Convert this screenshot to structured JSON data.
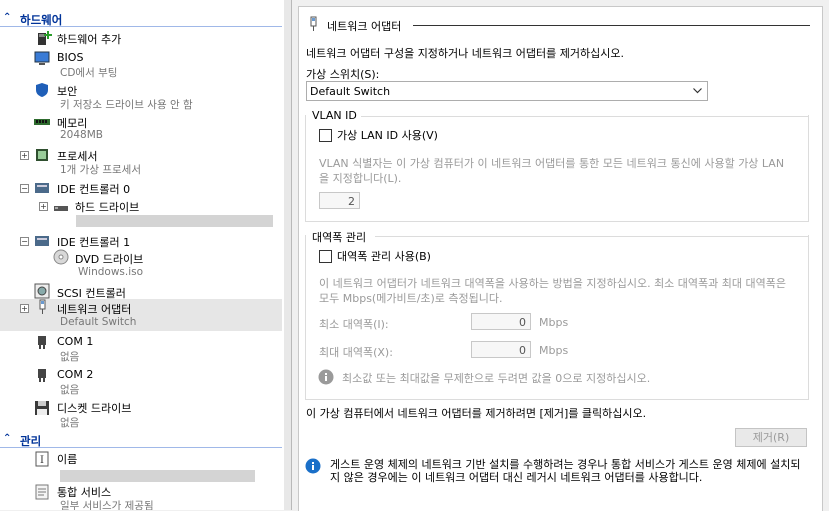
{
  "sidebar": {
    "hardware_header": "하드웨어",
    "management_header": "관리",
    "items": [
      {
        "label": "하드웨어 추가",
        "sub": ""
      },
      {
        "label": "BIOS",
        "sub": "CD에서 부팅"
      },
      {
        "label": "보안",
        "sub": "키 저장소 드라이브 사용 안 함"
      },
      {
        "label": "메모리",
        "sub": "2048MB"
      },
      {
        "label": "프로세서",
        "sub": "1개 가상 프로세서"
      },
      {
        "label": "IDE 컨트롤러 0",
        "sub": ""
      },
      {
        "label": "하드 드라이브",
        "sub": ""
      },
      {
        "label": "IDE 컨트롤러 1",
        "sub": ""
      },
      {
        "label": "DVD 드라이브",
        "sub": "Windows.iso"
      },
      {
        "label": "SCSI 컨트롤러",
        "sub": ""
      },
      {
        "label": "네트워크 어댑터",
        "sub": "Default Switch"
      },
      {
        "label": "COM 1",
        "sub": "없음"
      },
      {
        "label": "COM 2",
        "sub": "없음"
      },
      {
        "label": "디스켓 드라이브",
        "sub": "없음"
      }
    ],
    "mgmt_items": [
      {
        "label": "이름",
        "sub": ""
      },
      {
        "label": "통합 서비스",
        "sub": "일부 서비스가 제공됨"
      }
    ]
  },
  "panel": {
    "title": "네트워크 어댑터",
    "description": "네트워크 어댑터 구성을 지정하거나 네트워크 어댑터를 제거하십시오.",
    "switch_label": "가상 스위치(S):",
    "switch_value": "Default Switch",
    "vlan": {
      "header": "VLAN ID",
      "checkbox_label": "가상 LAN ID 사용(V)",
      "help": "VLAN 식별자는 이 가상 컴퓨터가 이 네트워크 어댑터를 통한 모든 네트워크 통신에 사용할 가상 LAN을 지정합니다(L).",
      "value": "2"
    },
    "bandwidth": {
      "header": "대역폭 관리",
      "checkbox_label": "대역폭 관리 사용(B)",
      "help": "이 네트워크 어댑터가 네트워크 대역폭을 사용하는 방법을 지정하십시오. 최소 대역폭과 최대 대역폭은 모두 Mbps(메가비트/초)로 측정됩니다.",
      "min_label": "최소 대역폭(I):",
      "min_value": "0",
      "max_label": "최대 대역폭(X):",
      "max_value": "0",
      "unit": "Mbps",
      "info": "최소값 또는 최대값을 무제한으로 두려면 값을 0으로 지정하십시오."
    },
    "remove_text": "이 가상 컴퓨터에서 네트워크 어댑터를 제거하려면 [제거]를 클릭하십시오.",
    "remove_button": "제거(R)",
    "footer_info": "게스트 운영 체제의 네트워크 기반 설치를 수행하려는 경우나 통합 서비스가 게스트 운영 체제에 설치되지 않은 경우에는 이 네트워크 어댑터 대신 레거시 네트워크 어댑터를 사용합니다."
  },
  "colors": {
    "accent": "#003399",
    "info_blue": "#1a6fc8"
  }
}
